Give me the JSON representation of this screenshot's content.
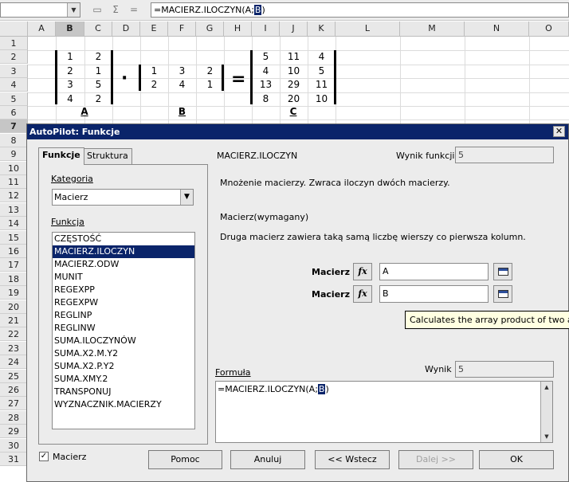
{
  "formula_bar": {
    "icons": [
      "dropdown-icon",
      "function-wizard-icon",
      "sum-icon",
      "equals-icon"
    ],
    "formula_prefix": "=MACIERZ.ILOCZYN(A;",
    "formula_selected": "B",
    "formula_suffix": ")"
  },
  "sheet": {
    "columns": [
      "A",
      "B",
      "C",
      "D",
      "E",
      "F",
      "G",
      "H",
      "I",
      "J",
      "K",
      "L",
      "M",
      "N",
      "O"
    ],
    "active_column": "B",
    "active_row": "7",
    "rows": [
      "1",
      "2",
      "3",
      "4",
      "5",
      "6",
      "7",
      "8",
      "9",
      "10",
      "11",
      "12",
      "13",
      "14",
      "15",
      "16",
      "17",
      "18",
      "19",
      "20",
      "21",
      "22",
      "23",
      "24",
      "25",
      "26",
      "27",
      "28",
      "29",
      "30",
      "31"
    ],
    "matrix_a": [
      [
        "1",
        "2"
      ],
      [
        "2",
        "1"
      ],
      [
        "3",
        "5"
      ],
      [
        "4",
        "2"
      ]
    ],
    "matrix_b": [
      [
        "1",
        "3",
        "2"
      ],
      [
        "2",
        "4",
        "1"
      ]
    ],
    "matrix_c": [
      [
        "5",
        "11",
        "4"
      ],
      [
        "4",
        "10",
        "5"
      ],
      [
        "13",
        "29",
        "11"
      ],
      [
        "8",
        "20",
        "10"
      ]
    ],
    "operator_mult": "·",
    "operator_eq": "=",
    "label_a": "A",
    "label_b": "B",
    "label_c": "C"
  },
  "dialog": {
    "title": "AutoPilot: Funkcje",
    "close_glyph": "✕",
    "tabs": [
      "Funkcje",
      "Struktura"
    ],
    "category_label": "Kategoria",
    "category_value": "Macierz",
    "function_label": "Funkcja",
    "functions": [
      "CZĘSTOŚĆ",
      "MACIERZ.ILOCZYN",
      "MACIERZ.ODW",
      "MUNIT",
      "REGEXPP",
      "REGEXPW",
      "REGLINP",
      "REGLINW",
      "SUMA.ILOCZYNÓW",
      "SUMA.X2.M.Y2",
      "SUMA.X2.P.Y2",
      "SUMA.XMY.2",
      "TRANSPONUJ",
      "WYZNACZNIK.MACIERZY"
    ],
    "selected_function": "MACIERZ.ILOCZYN",
    "function_name": "MACIERZ.ILOCZYN",
    "result_label": "Wynik funkcji",
    "result_value": "5",
    "description": "Mnożenie macierzy. Zwraca iloczyn dwóch macierzy.",
    "arg_title": "Macierz(wymagany)",
    "arg_description": "Druga macierz zawiera taką samą liczbę wierszy co pierwsza kolumn.",
    "args": [
      {
        "name": "Macierz",
        "fx": "fx",
        "value": "A"
      },
      {
        "name": "Macierz",
        "fx": "fx",
        "value": "B"
      }
    ],
    "tooltip": "Calculates the array product of two arrays.",
    "formula_label": "Formuła",
    "wynik_label": "Wynik",
    "wynik_value": "5",
    "formula_prefix": "=MACIERZ.ILOCZYN(A;",
    "formula_selected": "B",
    "formula_suffix": ")",
    "array_checkbox_label": "Macierz",
    "array_checked": true,
    "buttons": {
      "help": "Pomoc",
      "cancel": "Anuluj",
      "back": "<< Wstecz",
      "next": "Dalej >>",
      "ok": "OK"
    }
  }
}
